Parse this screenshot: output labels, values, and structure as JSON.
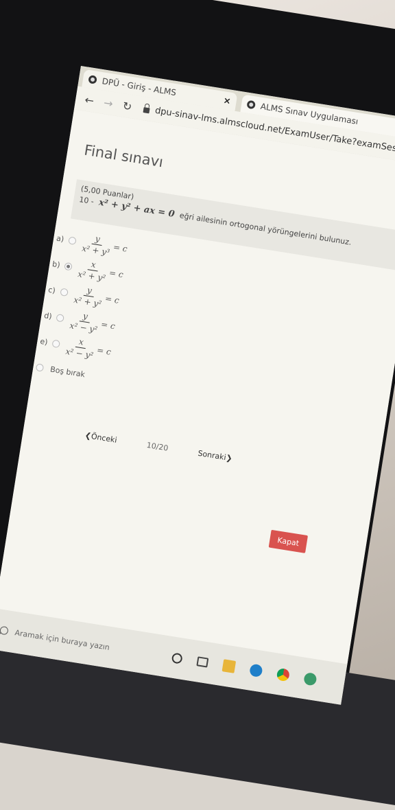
{
  "browser": {
    "tabs": [
      {
        "title": "DPÜ - Giriş - ALMS",
        "active": true
      },
      {
        "title": "ALMS Sınav Uygulaması",
        "active": false
      }
    ],
    "url": "dpu-sinav-lms.almscloud.net/ExamUser/Take?examSession"
  },
  "exam": {
    "title": "Final sınavı",
    "points": "(5,00 Puanlar)",
    "question_number": "10 -",
    "question_formula": "x² + y² + ax = 0",
    "question_text": "eğri ailesinin ortogonal yörüngelerini bulunuz.",
    "options": [
      {
        "label": "a)",
        "num": "y",
        "den": "x² + y³",
        "rhs": "= c",
        "selected": false
      },
      {
        "label": "b)",
        "num": "x",
        "den": "x² + y²",
        "rhs": "= c",
        "selected": true
      },
      {
        "label": "c)",
        "num": "y",
        "den": "x² + y²",
        "rhs": "= c",
        "selected": false
      },
      {
        "label": "d)",
        "num": "y",
        "den": "x² − y²",
        "rhs": "= c",
        "selected": false
      },
      {
        "label": "e)",
        "num": "x",
        "den": "x² − y²",
        "rhs": "= c",
        "selected": false
      }
    ],
    "skip_label": "Boş bırak",
    "prev_label": "❮Önceki",
    "progress": "10/20",
    "next_label": "Sonraki❯",
    "close_label": "Kapat"
  },
  "taskbar": {
    "search_placeholder": "Aramak için buraya yazın"
  }
}
